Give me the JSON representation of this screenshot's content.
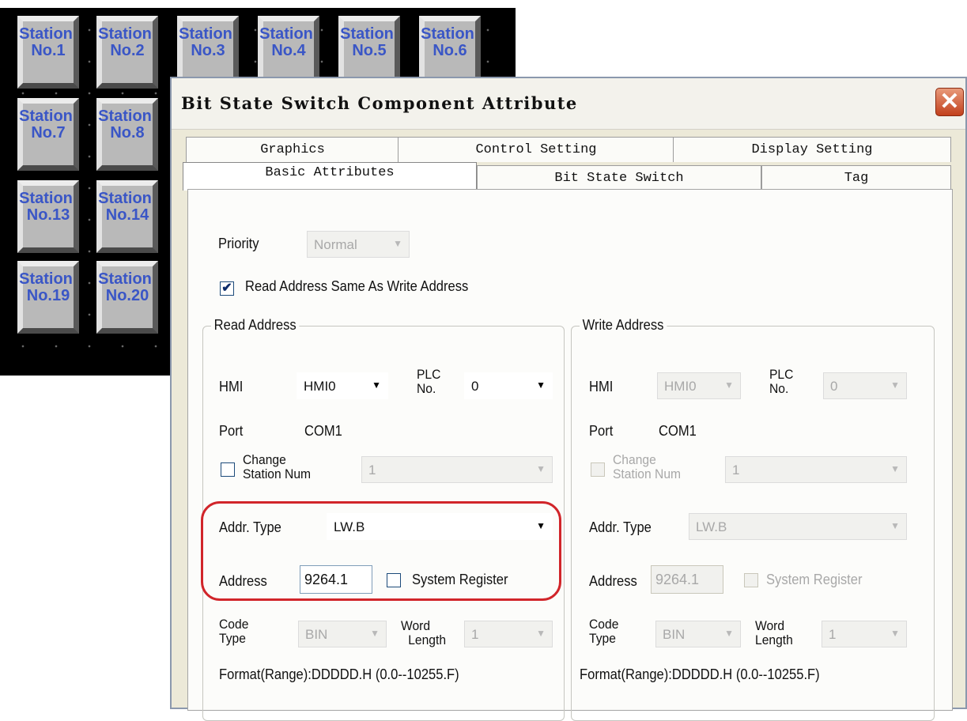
{
  "stations": [
    {
      "t": "Station",
      "n": "No.1"
    },
    {
      "t": "Station",
      "n": "No.2"
    },
    {
      "t": "Station",
      "n": "No.3"
    },
    {
      "t": "Station",
      "n": "No.4"
    },
    {
      "t": "Station",
      "n": "No.5"
    },
    {
      "t": "Station",
      "n": "No.6"
    },
    {
      "t": "Station",
      "n": "No.7"
    },
    {
      "t": "Station",
      "n": "No.8"
    },
    {
      "t": "Station",
      "n": "No.13"
    },
    {
      "t": "Station",
      "n": "No.14"
    },
    {
      "t": "Station",
      "n": "No.19"
    },
    {
      "t": "Station",
      "n": "No.20"
    }
  ],
  "dialog": {
    "title": "Bit State Switch Component Attribute",
    "close_glyph": "✕",
    "tabs_row1": [
      "Graphics",
      "Control Setting",
      "Display Setting"
    ],
    "tabs_row2": [
      "Basic Attributes",
      "Bit State Switch",
      "Tag"
    ],
    "priority": {
      "label": "Priority",
      "value": "Normal"
    },
    "same_address": {
      "label": "Read Address Same As Write Address",
      "checked": true,
      "mark": "✔"
    },
    "read": {
      "title": "Read Address",
      "hmi_label": "HMI",
      "hmi_value": "HMI0",
      "plc_label_1": "PLC",
      "plc_label_2": "No.",
      "plc_value": "0",
      "port_label": "Port",
      "port_value": "COM1",
      "change_1": "Change",
      "change_2": "Station Num",
      "change_value": "1",
      "addr_type_label": "Addr. Type",
      "addr_type_value": "LW.B",
      "address_label": "Address",
      "address_value": "9264.1",
      "sysreg_label": "System Register",
      "code_1": "Code",
      "code_2": "Type",
      "code_value": "BIN",
      "word_1": "Word",
      "word_2": "Length",
      "word_value": "1",
      "format": "Format(Range):DDDDD.H (0.0--10255.F)"
    },
    "write": {
      "title": "Write Address",
      "hmi_label": "HMI",
      "hmi_value": "HMI0",
      "plc_label_1": "PLC",
      "plc_label_2": "No.",
      "plc_value": "0",
      "port_label": "Port",
      "port_value": "COM1",
      "change_1": "Change",
      "change_2": "Station Num",
      "change_value": "1",
      "addr_type_label": "Addr. Type",
      "addr_type_value": "LW.B",
      "address_label": "Address",
      "address_value": "9264.1",
      "sysreg_label": "System Register",
      "code_1": "Code",
      "code_2": "Type",
      "code_value": "BIN",
      "word_1": "Word",
      "word_2": "Length",
      "word_value": "1",
      "format": "Format(Range):DDDDD.H (0.0--10255.F)"
    },
    "arrow_glyph": "▼",
    "highlight_color": "#d1252a"
  }
}
